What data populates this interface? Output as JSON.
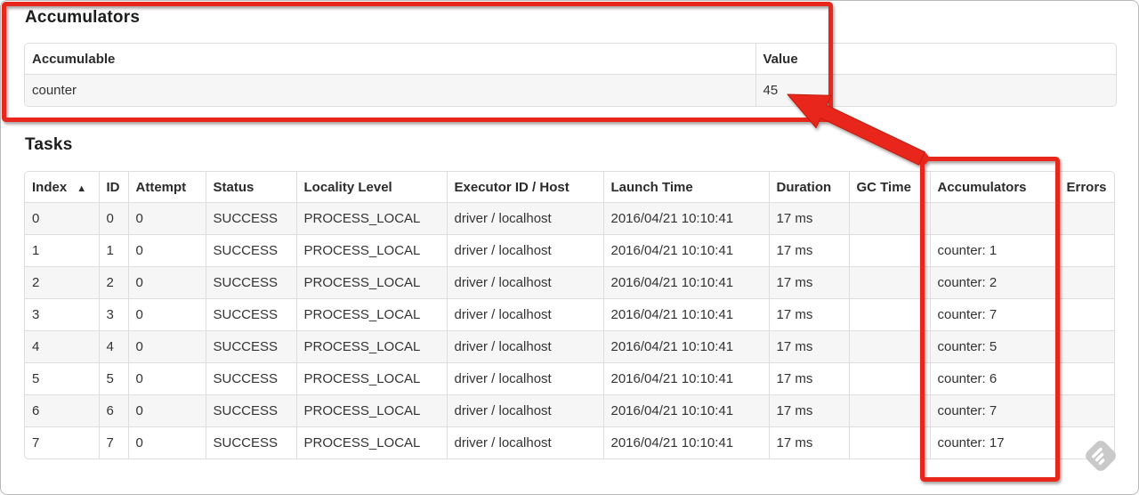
{
  "annotation": {
    "color": "#e8271c"
  },
  "accumulators_section": {
    "title": "Accumulators",
    "table": {
      "headers": [
        "Accumulable",
        "Value"
      ],
      "rows": [
        [
          "counter",
          "45"
        ]
      ]
    }
  },
  "tasks_section": {
    "title": "Tasks",
    "table": {
      "sort_icon": "▲",
      "headers": [
        "Index",
        "ID",
        "Attempt",
        "Status",
        "Locality Level",
        "Executor ID / Host",
        "Launch Time",
        "Duration",
        "GC Time",
        "Accumulators",
        "Errors"
      ],
      "rows": [
        [
          "0",
          "0",
          "0",
          "SUCCESS",
          "PROCESS_LOCAL",
          "driver / localhost",
          "2016/04/21 10:10:41",
          "17 ms",
          "",
          "",
          ""
        ],
        [
          "1",
          "1",
          "0",
          "SUCCESS",
          "PROCESS_LOCAL",
          "driver / localhost",
          "2016/04/21 10:10:41",
          "17 ms",
          "",
          "counter: 1",
          ""
        ],
        [
          "2",
          "2",
          "0",
          "SUCCESS",
          "PROCESS_LOCAL",
          "driver / localhost",
          "2016/04/21 10:10:41",
          "17 ms",
          "",
          "counter: 2",
          ""
        ],
        [
          "3",
          "3",
          "0",
          "SUCCESS",
          "PROCESS_LOCAL",
          "driver / localhost",
          "2016/04/21 10:10:41",
          "17 ms",
          "",
          "counter: 7",
          ""
        ],
        [
          "4",
          "4",
          "0",
          "SUCCESS",
          "PROCESS_LOCAL",
          "driver / localhost",
          "2016/04/21 10:10:41",
          "17 ms",
          "",
          "counter: 5",
          ""
        ],
        [
          "5",
          "5",
          "0",
          "SUCCESS",
          "PROCESS_LOCAL",
          "driver / localhost",
          "2016/04/21 10:10:41",
          "17 ms",
          "",
          "counter: 6",
          ""
        ],
        [
          "6",
          "6",
          "0",
          "SUCCESS",
          "PROCESS_LOCAL",
          "driver / localhost",
          "2016/04/21 10:10:41",
          "17 ms",
          "",
          "counter: 7",
          ""
        ],
        [
          "7",
          "7",
          "0",
          "SUCCESS",
          "PROCESS_LOCAL",
          "driver / localhost",
          "2016/04/21 10:10:41",
          "17 ms",
          "",
          "counter: 17",
          ""
        ]
      ]
    }
  }
}
